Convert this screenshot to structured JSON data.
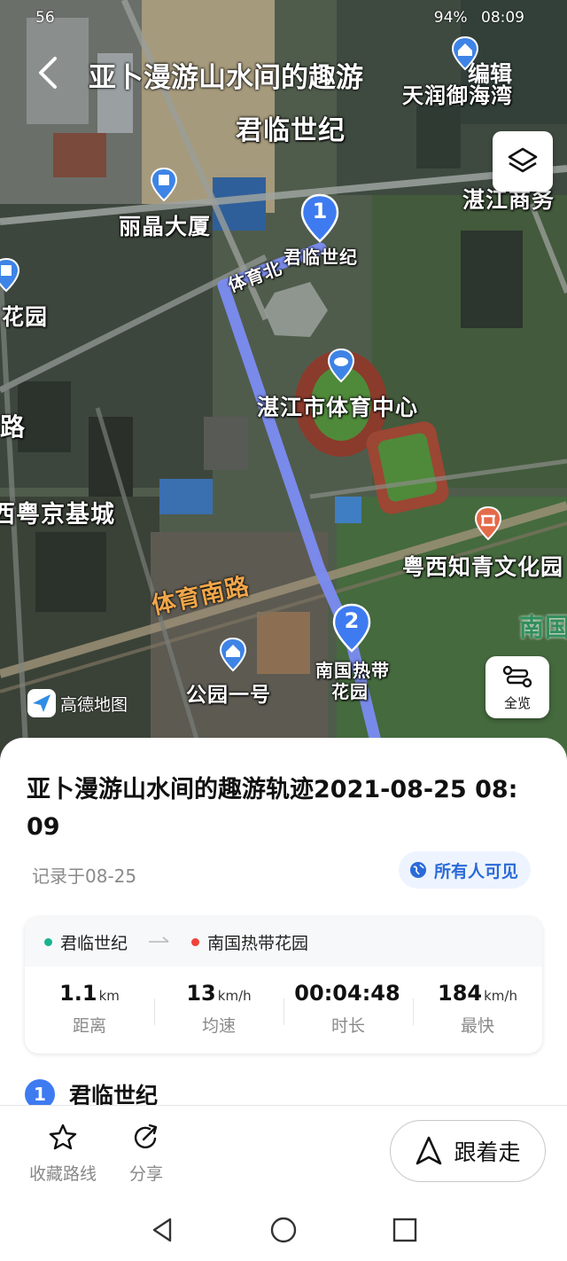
{
  "status_bar": {
    "left_text": "56",
    "battery": "94%",
    "time": "08:09"
  },
  "header": {
    "title": "亚卜漫游山水间的趣游",
    "edit_label": "编辑"
  },
  "map": {
    "labels": {
      "tianrun": "天润御海湾",
      "junlin_area": "君临世纪",
      "zhanjiang_shangwu": "湛江商务",
      "lijing": "丽晶大厦",
      "huayuan": "花园",
      "road_tiyu_bei": "体育北",
      "sports_center": "湛江市体育中心",
      "lu": "路",
      "yuejing": "西粤京基城",
      "yuexi_zhiqing": "粤西知青文化园",
      "nan": "南国",
      "road_tiyu_nan": "体育南路",
      "gongyuan": "公园一号",
      "start_label": "君临世纪",
      "end_label_1": "南国热带",
      "end_label_2": "花园"
    },
    "waypoints": [
      "1",
      "2"
    ],
    "logo_text": "高德地图",
    "overview_label": "全览",
    "route_color": "#7b8cf2",
    "marker_color": "#3e7bf0"
  },
  "sheet": {
    "title": "亚卜漫游山水间的趣游轨迹2021-08-25 08:09",
    "recorded": "记录于08-25",
    "visibility": "所有人可见",
    "route": {
      "start": "君临世纪",
      "end": "南国热带花园",
      "start_color": "#19b38f",
      "end_color": "#f0433a"
    },
    "stats": [
      {
        "value": "1.1",
        "unit": "km",
        "label": "距离"
      },
      {
        "value": "13",
        "unit": "km/h",
        "label": "均速"
      },
      {
        "value": "00:04:48",
        "unit": "",
        "label": "时长"
      },
      {
        "value": "184",
        "unit": "km/h",
        "label": "最快"
      }
    ],
    "first_waypoint": {
      "index": "1",
      "name": "君临世纪"
    }
  },
  "actions": {
    "favorite": "收藏路线",
    "share": "分享",
    "follow": "跟着走"
  }
}
